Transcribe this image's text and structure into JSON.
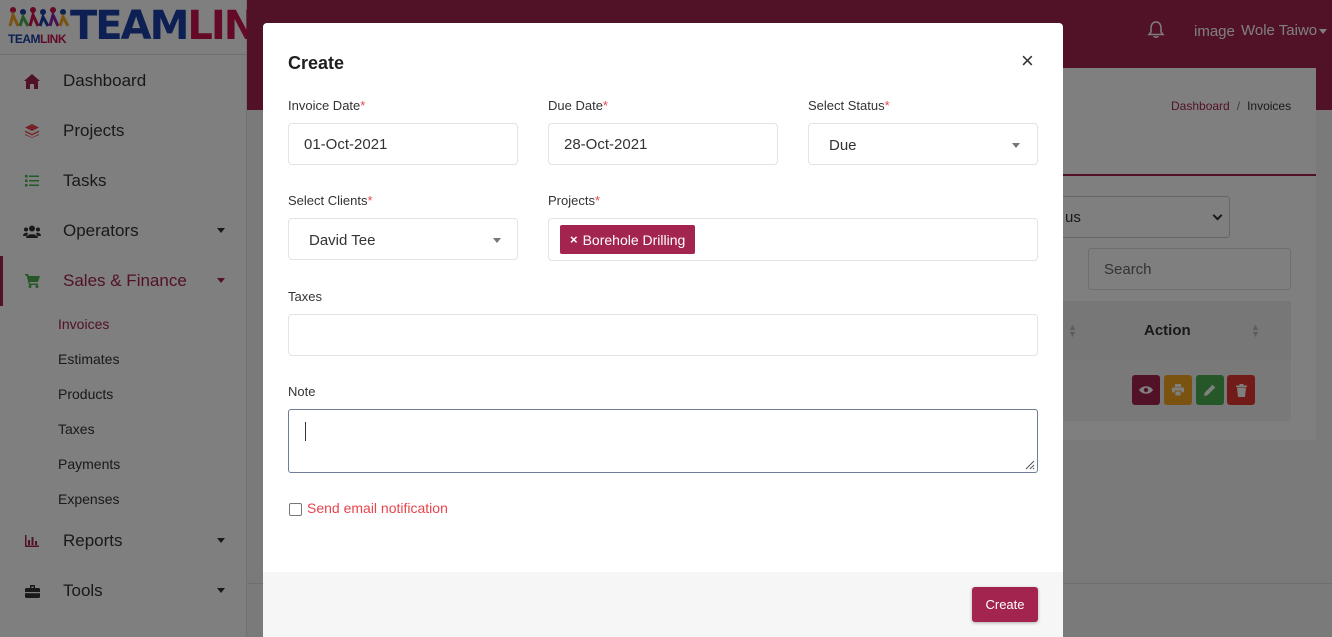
{
  "brand": {
    "small_left": "TEAM",
    "small_right": "LINK",
    "big_left": "TEAM",
    "big_right": "LINK"
  },
  "sidebar": {
    "items": [
      {
        "label": "Dashboard",
        "icon": "home-icon"
      },
      {
        "label": "Projects",
        "icon": "layers-icon"
      },
      {
        "label": "Tasks",
        "icon": "list-icon"
      },
      {
        "label": "Operators",
        "icon": "users-icon"
      },
      {
        "label": "Sales & Finance",
        "icon": "cart-icon"
      },
      {
        "label": "Reports",
        "icon": "chart-icon"
      },
      {
        "label": "Tools",
        "icon": "toolbox-icon"
      }
    ],
    "sub_items": [
      "Invoices",
      "Estimates",
      "Products",
      "Taxes",
      "Payments",
      "Expenses"
    ]
  },
  "header": {
    "user_image_alt": "image",
    "user_name": "Wole Taiwo"
  },
  "breadcrumb": {
    "home": "Dashboard",
    "separator": "/",
    "current": "Invoices"
  },
  "page": {
    "status_filter_text": "us",
    "search_placeholder": "Search",
    "table": {
      "action_header": "Action"
    }
  },
  "modal": {
    "title": "Create",
    "close": "×",
    "required_mark": "*",
    "invoice_date": {
      "label": "Invoice Date",
      "value": "01-Oct-2021"
    },
    "due_date": {
      "label": "Due Date",
      "value": "28-Oct-2021"
    },
    "status": {
      "label": "Select Status",
      "value": "Due"
    },
    "clients": {
      "label": "Select Clients",
      "value": "David Tee"
    },
    "projects": {
      "label": "Projects",
      "tags": [
        "Borehole Drilling"
      ],
      "tag_remove": "×"
    },
    "taxes": {
      "label": "Taxes",
      "value": ""
    },
    "note": {
      "label": "Note",
      "value": ""
    },
    "email_notification": {
      "label": "Send email notification",
      "checked": false
    },
    "submit_label": "Create"
  },
  "colors": {
    "brand": "#a3244f",
    "required": "#e8454d",
    "view": "#a3244f",
    "print": "#f5a623",
    "edit": "#4caf50",
    "delete": "#e53935"
  }
}
